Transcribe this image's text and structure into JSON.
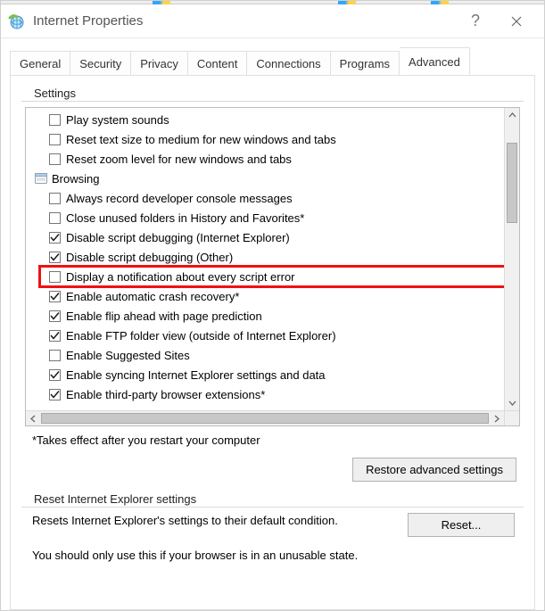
{
  "window": {
    "title": "Internet Properties",
    "help_tooltip": "?",
    "close_tooltip": "Close"
  },
  "tabs": [
    {
      "label": "General"
    },
    {
      "label": "Security"
    },
    {
      "label": "Privacy"
    },
    {
      "label": "Content"
    },
    {
      "label": "Connections"
    },
    {
      "label": "Programs"
    },
    {
      "label": "Advanced",
      "active": true
    }
  ],
  "settings": {
    "group_label": "Settings",
    "items": [
      {
        "type": "check",
        "checked": false,
        "label": "Play system sounds"
      },
      {
        "type": "check",
        "checked": false,
        "label": "Reset text size to medium for new windows and tabs"
      },
      {
        "type": "check",
        "checked": false,
        "label": "Reset zoom level for new windows and tabs"
      },
      {
        "type": "category",
        "label": "Browsing"
      },
      {
        "type": "check",
        "checked": false,
        "label": "Always record developer console messages"
      },
      {
        "type": "check",
        "checked": false,
        "label": "Close unused folders in History and Favorites*"
      },
      {
        "type": "check",
        "checked": true,
        "label": "Disable script debugging (Internet Explorer)"
      },
      {
        "type": "check",
        "checked": true,
        "label": "Disable script debugging (Other)"
      },
      {
        "type": "check",
        "checked": false,
        "label": "Display a notification about every script error",
        "highlight": true
      },
      {
        "type": "check",
        "checked": true,
        "label": "Enable automatic crash recovery*"
      },
      {
        "type": "check",
        "checked": true,
        "label": "Enable flip ahead with page prediction"
      },
      {
        "type": "check",
        "checked": true,
        "label": "Enable FTP folder view (outside of Internet Explorer)"
      },
      {
        "type": "check",
        "checked": false,
        "label": "Enable Suggested Sites"
      },
      {
        "type": "check",
        "checked": true,
        "label": "Enable syncing Internet Explorer settings and data"
      },
      {
        "type": "check",
        "checked": true,
        "label": "Enable third-party browser extensions*",
        "cut": true
      }
    ],
    "footnote": "*Takes effect after you restart your computer",
    "restore_button": "Restore advanced settings"
  },
  "reset_group": {
    "group_label": "Reset Internet Explorer settings",
    "desc": "Resets Internet Explorer's settings to their default condition.",
    "reset_button": "Reset...",
    "warning": "You should only use this if your browser is in an unusable state."
  }
}
